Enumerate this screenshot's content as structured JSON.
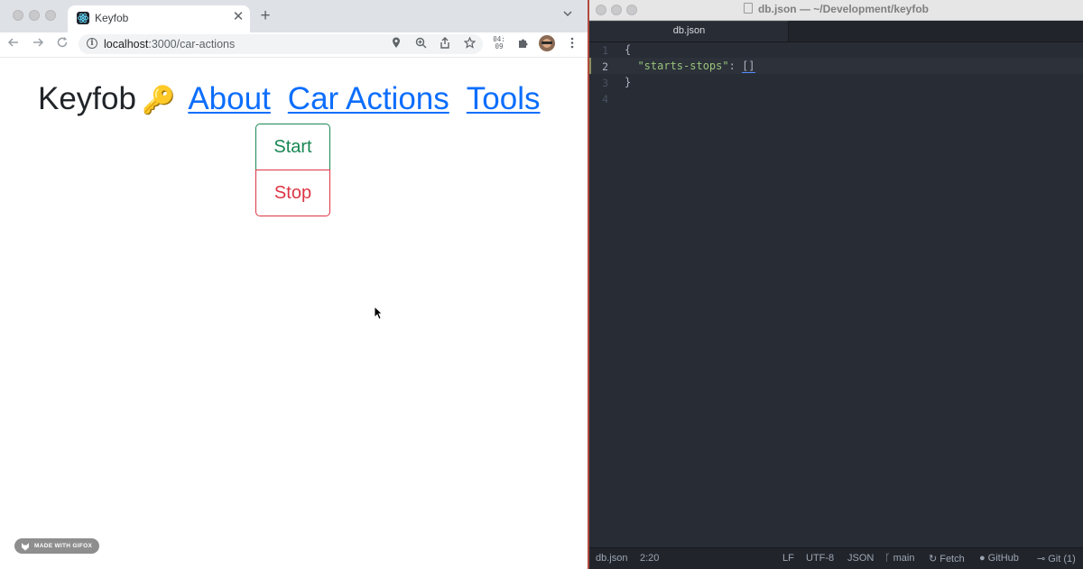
{
  "browser": {
    "tab": {
      "title": "Keyfob",
      "favicon": "react-icon"
    },
    "address": {
      "host": "localhost",
      "path": ":3000/car-actions"
    },
    "extension_clock": {
      "line1": "04:",
      "line2": "09"
    }
  },
  "page": {
    "brand": "Keyfob",
    "brand_icon": "🔑",
    "nav_links": [
      "About",
      "Car Actions",
      "Tools"
    ],
    "buttons": {
      "start": "Start",
      "stop": "Stop"
    },
    "watermark": "MADE WITH GIFOX",
    "colors": {
      "link": "#0d6efd",
      "start": "#198754",
      "stop": "#dc3545"
    }
  },
  "editor": {
    "window_title": "db.json — ~/Development/keyfob",
    "tab": "db.json",
    "line_numbers": [
      "1",
      "2",
      "3",
      "4"
    ],
    "lines": {
      "l1": "{",
      "l2_indent": "  ",
      "l2_key": "\"starts-stops\"",
      "l2_sep": ": ",
      "l2_value": "[]",
      "l3": "}"
    },
    "status": {
      "file": "db.json",
      "cursor": "2:20",
      "line_ending": "LF",
      "encoding": "UTF-8",
      "grammar": "JSON",
      "branch": "main",
      "fetch": "Fetch",
      "github": "GitHub",
      "git": "Git (1)"
    },
    "colors": {
      "background": "#282c34",
      "string": "#98c379"
    }
  }
}
